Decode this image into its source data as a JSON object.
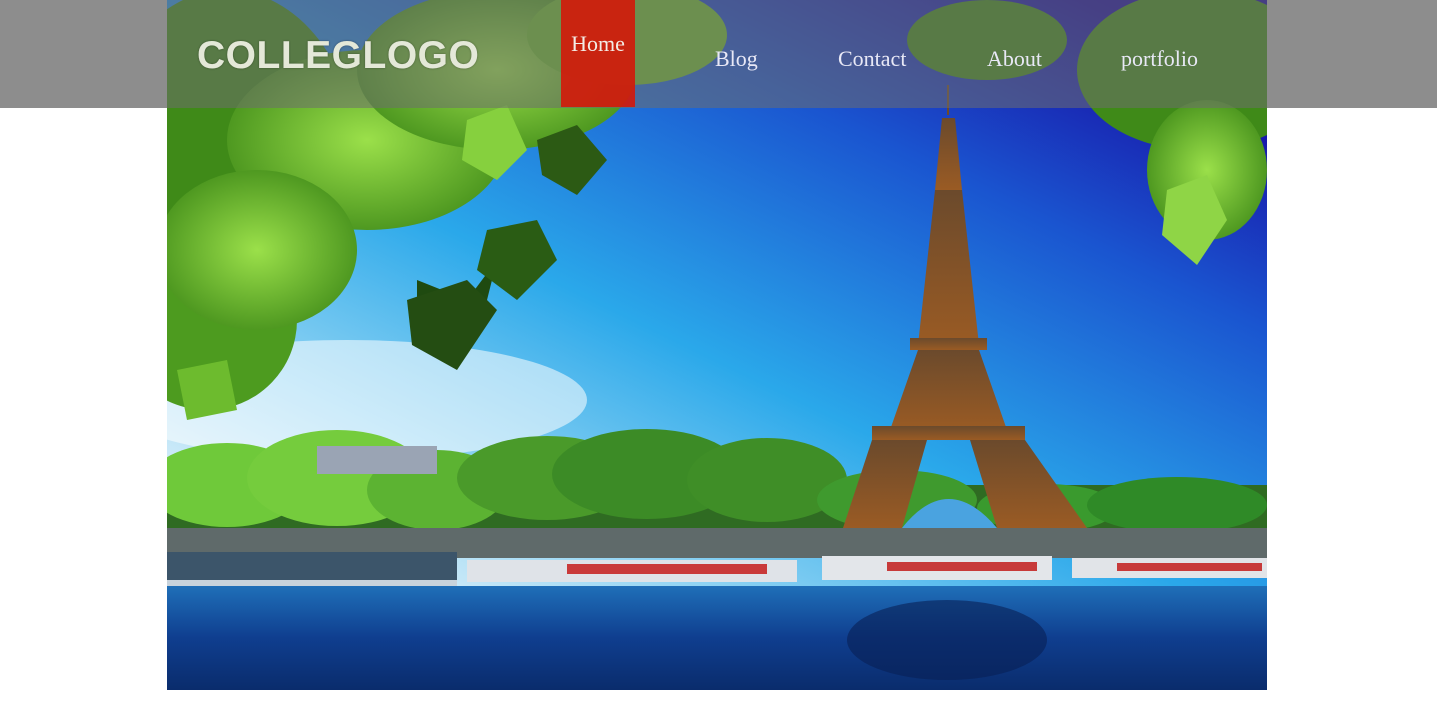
{
  "header": {
    "logo": "COLLEGLOGO",
    "nav": [
      {
        "label": "Home",
        "active": true
      },
      {
        "label": "Blog",
        "active": false
      },
      {
        "label": "Contact",
        "active": false
      },
      {
        "label": "About",
        "active": false
      },
      {
        "label": "portfolio",
        "active": false
      }
    ]
  },
  "colors": {
    "topbar": "#8d8d8d",
    "active_nav": "#d61608",
    "sky_top": "#1a0fa8",
    "sky_bottom": "#2ea6e6",
    "water": "#0d3a86",
    "foliage": "#4f9e1c",
    "tower": "#8a5525"
  },
  "hero": {
    "image": "eiffel-tower-seine-river-photo"
  }
}
